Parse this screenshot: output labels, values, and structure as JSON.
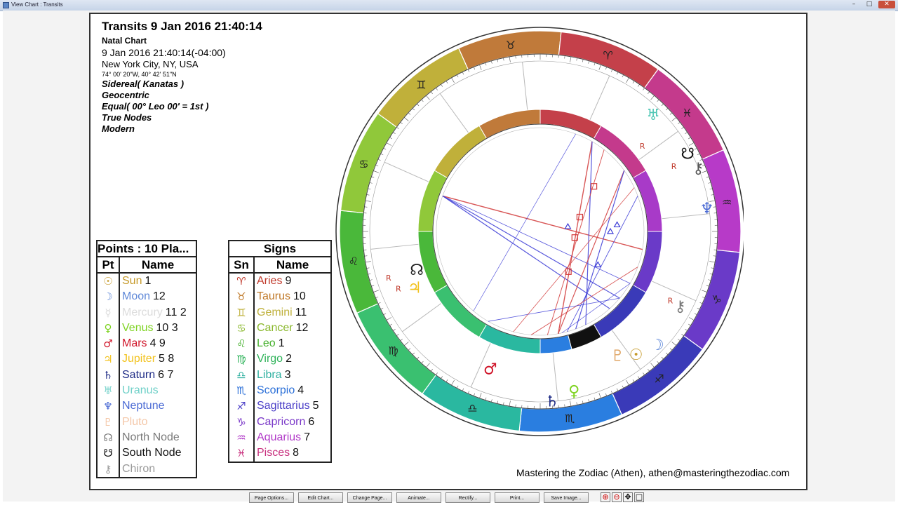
{
  "window": {
    "title": "View Chart : Transits"
  },
  "header": {
    "title": "Transits 9 Jan 2016 21:40:14",
    "chart_kind": "Natal Chart",
    "datetime": "9 Jan 2016 21:40:14(-04:00)",
    "location": "New York City, NY, USA",
    "coords": "74° 00' 20\"W, 40° 42' 51\"N",
    "settings": [
      "Sidereal( Kanatas )",
      "Geocentric",
      "Equal( 00° Leo 00' = 1st )",
      "True Nodes",
      "Modern"
    ]
  },
  "points_table": {
    "caption": "Points : 10 Pla...",
    "col_symbol": "Pt",
    "col_name": "Name",
    "rows": [
      {
        "symbol": "☉",
        "name": "Sun",
        "num": "1",
        "color": "#c69a2a"
      },
      {
        "symbol": "☽",
        "name": "Moon",
        "num": "12",
        "color": "#5f88d8"
      },
      {
        "symbol": "☿",
        "name": "Mercury",
        "num": "11 2",
        "color": "#dcdcdc"
      },
      {
        "symbol": "♀",
        "name": "Venus",
        "num": "10 3",
        "color": "#7ed321"
      },
      {
        "symbol": "♂",
        "name": "Mars",
        "num": "4 9",
        "color": "#d0162a"
      },
      {
        "symbol": "♃",
        "name": "Jupiter",
        "num": "5 8",
        "color": "#f2c21c"
      },
      {
        "symbol": "♄",
        "name": "Saturn",
        "num": "6 7",
        "color": "#1f2c86"
      },
      {
        "symbol": "♅",
        "name": "Uranus",
        "num": "",
        "color": "#6fd0c8"
      },
      {
        "symbol": "♆",
        "name": "Neptune",
        "num": "",
        "color": "#4a6ad4"
      },
      {
        "symbol": "♇",
        "name": "Pluto",
        "num": "",
        "color": "#f4c7a8"
      },
      {
        "symbol": "☊",
        "name": "North Node",
        "num": "",
        "color": "#7a7a7a"
      },
      {
        "symbol": "☋",
        "name": "South Node",
        "num": "",
        "color": "#111111"
      },
      {
        "symbol": "⚷",
        "name": "Chiron",
        "num": "",
        "color": "#9a9a9a"
      }
    ]
  },
  "signs_table": {
    "caption": "Signs",
    "col_symbol": "Sn",
    "col_name": "Name",
    "rows": [
      {
        "symbol": "♈",
        "name": "Aries",
        "num": "9",
        "color": "#c0392b"
      },
      {
        "symbol": "♉",
        "name": "Taurus",
        "num": "10",
        "color": "#c07a2a"
      },
      {
        "symbol": "♊",
        "name": "Gemini",
        "num": "11",
        "color": "#bfb13c"
      },
      {
        "symbol": "♋",
        "name": "Cancer",
        "num": "12",
        "color": "#8ab82c"
      },
      {
        "symbol": "♌",
        "name": "Leo",
        "num": "1",
        "color": "#45b02c"
      },
      {
        "symbol": "♍",
        "name": "Virgo",
        "num": "2",
        "color": "#2fb35a"
      },
      {
        "symbol": "♎",
        "name": "Libra",
        "num": "3",
        "color": "#2fb0a0"
      },
      {
        "symbol": "♏",
        "name": "Scorpio",
        "num": "4",
        "color": "#2a6fd8"
      },
      {
        "symbol": "♐",
        "name": "Sagittarius",
        "num": "5",
        "color": "#4b3fc8"
      },
      {
        "symbol": "♑",
        "name": "Capricorn",
        "num": "6",
        "color": "#7a38c8"
      },
      {
        "symbol": "♒",
        "name": "Aquarius",
        "num": "7",
        "color": "#b13ac8"
      },
      {
        "symbol": "♓",
        "name": "Pisces",
        "num": "8",
        "color": "#c8307e"
      }
    ]
  },
  "wheel": {
    "outer_signs": [
      {
        "glyph": "♉",
        "color": "#c07a3a"
      },
      {
        "glyph": "♈",
        "color": "#c4404a"
      },
      {
        "glyph": "♓",
        "color": "#c43a8c"
      },
      {
        "glyph": "♒",
        "color": "#b73ac8"
      },
      {
        "glyph": "♑",
        "color": "#6a3ac8"
      },
      {
        "glyph": "♐",
        "color": "#3a3ab8"
      },
      {
        "glyph": "♏",
        "color": "#2a7ee0"
      },
      {
        "glyph": "♎",
        "color": "#2ab8a0"
      },
      {
        "glyph": "♍",
        "color": "#3ac070"
      },
      {
        "glyph": "♌",
        "color": "#4ab83a"
      },
      {
        "glyph": "♋",
        "color": "#90c83a"
      },
      {
        "glyph": "♊",
        "color": "#c0b03a"
      }
    ],
    "outer_planets": [
      {
        "glyph": "♅",
        "color": "#4fc7b5"
      },
      {
        "glyph": "☋",
        "color": "#111111"
      },
      {
        "glyph": "⚷",
        "color": "#555555"
      },
      {
        "glyph": "♆",
        "color": "#4a6ad4"
      },
      {
        "glyph": "⚷",
        "color": "#777777"
      },
      {
        "glyph": "☽",
        "color": "#5f88d8"
      },
      {
        "glyph": "☉",
        "color": "#c69a2a"
      },
      {
        "glyph": "♇",
        "color": "#e0a86a"
      },
      {
        "glyph": "♀",
        "color": "#7ed321"
      },
      {
        "glyph": "♄",
        "color": "#1f2c86"
      },
      {
        "glyph": "♂",
        "color": "#d0162a"
      },
      {
        "glyph": "♃",
        "color": "#f2c21c"
      },
      {
        "glyph": "☊",
        "color": "#222222"
      }
    ],
    "retro_mark": "R"
  },
  "credit": "Mastering the Zodiac (Athen), athen@masteringthezodiac.com",
  "buttons": [
    "Page Options...",
    "Edit Chart...",
    "Change Page...",
    "Animate...",
    "Rectify...",
    "Print...",
    "Save Image..."
  ],
  "window_buttons": [
    "–",
    "□",
    "✕"
  ]
}
